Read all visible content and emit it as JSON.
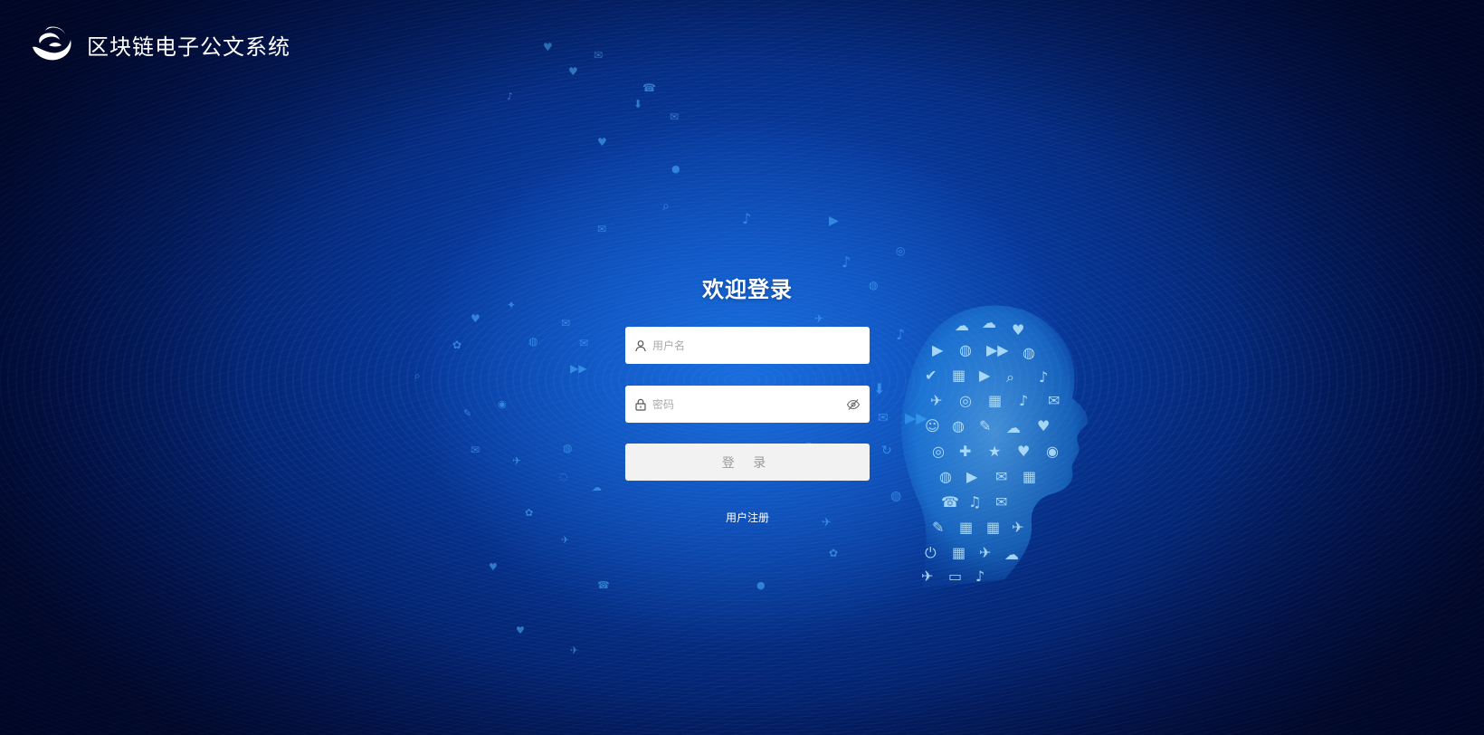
{
  "app": {
    "title": "区块链电子公文系统"
  },
  "login": {
    "heading": "欢迎登录",
    "username": {
      "placeholder": "用户名",
      "value": ""
    },
    "password": {
      "placeholder": "密码",
      "value": ""
    },
    "submit_label": "登 录",
    "register_label": "用户注册"
  },
  "icons": {
    "logo": "swirl-logo-icon",
    "username": "user-icon",
    "password": "lock-icon",
    "toggle_password": "eye-slash-icon"
  },
  "colors": {
    "background": "#073a9e",
    "accent": "#4fb6ff",
    "button_bg": "#f2f2f2",
    "button_text": "#9b9b9b"
  }
}
